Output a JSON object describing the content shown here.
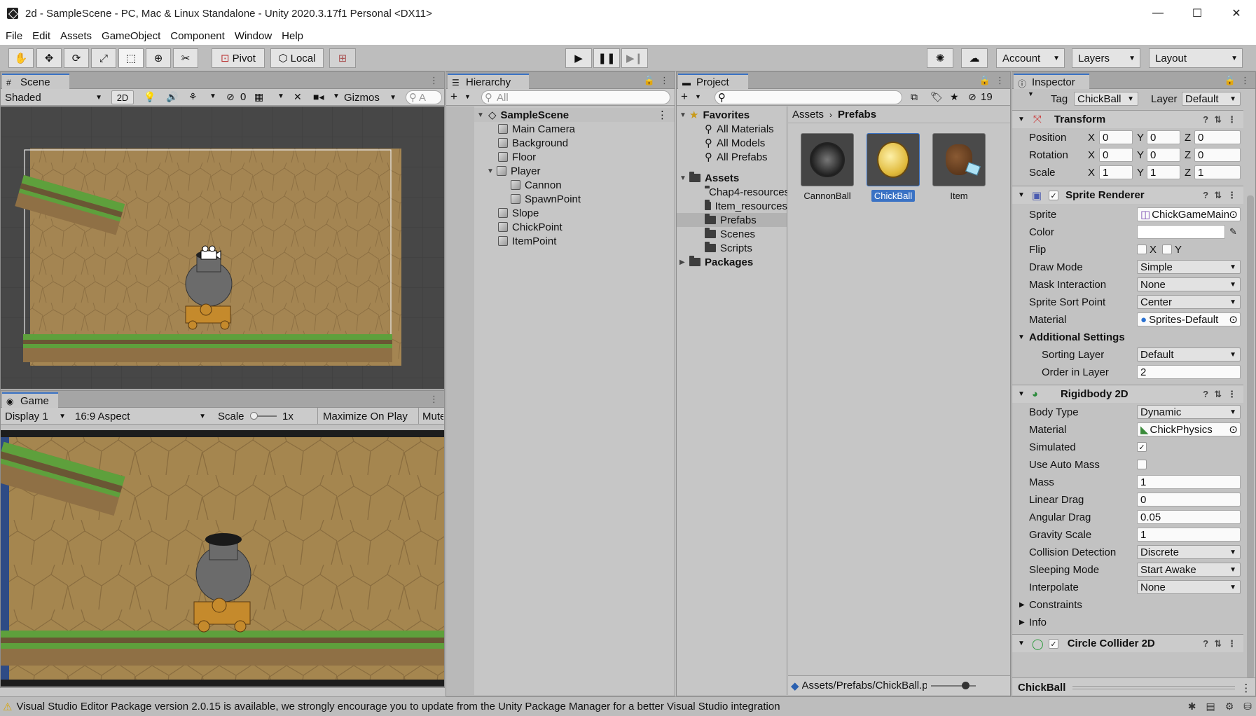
{
  "window": {
    "title": "2d - SampleScene - PC, Mac & Linux Standalone - Unity 2020.3.17f1 Personal <DX11>",
    "controls": [
      "—",
      "☐",
      "✕"
    ]
  },
  "menu": [
    "File",
    "Edit",
    "Assets",
    "GameObject",
    "Component",
    "Window",
    "Help"
  ],
  "toolbar": {
    "pivot": "Pivot",
    "local": "Local",
    "account": "Account",
    "layers": "Layers",
    "layout": "Layout"
  },
  "scene": {
    "tab": "Scene",
    "shading": "Shaded",
    "mode_2d": "2D",
    "hidden_count": "0",
    "gizmos": "Gizmos",
    "search_placeholder": "A"
  },
  "game": {
    "tab": "Game",
    "display": "Display 1",
    "aspect": "16:9 Aspect",
    "scale_label": "Scale",
    "scale_value": "1x",
    "maximize": "Maximize On Play",
    "mute": "Mute"
  },
  "hierarchy": {
    "tab": "Hierarchy",
    "search_placeholder": "All",
    "scene": "SampleScene",
    "items": [
      {
        "label": "Main Camera",
        "depth": 1
      },
      {
        "label": "Background",
        "depth": 1
      },
      {
        "label": "Floor",
        "depth": 1
      },
      {
        "label": "Player",
        "depth": 1,
        "expanded": true
      },
      {
        "label": "Cannon",
        "depth": 2
      },
      {
        "label": "SpawnPoint",
        "depth": 2
      },
      {
        "label": "Slope",
        "depth": 1
      },
      {
        "label": "ChickPoint",
        "depth": 1
      },
      {
        "label": "ItemPoint",
        "depth": 1
      }
    ]
  },
  "project": {
    "tab": "Project",
    "hidden_count": "19",
    "favorites": "Favorites",
    "favorite_items": [
      "All Materials",
      "All Models",
      "All Prefabs"
    ],
    "assets": "Assets",
    "asset_folders": [
      "Chap4-resources",
      "Item_resources",
      "Prefabs",
      "Scenes",
      "Scripts"
    ],
    "packages": "Packages",
    "breadcrumb": [
      "Assets",
      "Prefabs"
    ],
    "prefabs": [
      "CannonBall",
      "ChickBall",
      "Item"
    ],
    "selected_prefab": "ChickBall",
    "footer_path": "Assets/Prefabs/ChickBall.prefab"
  },
  "inspector": {
    "tab": "Inspector",
    "tag_label": "Tag",
    "tag_value": "ChickBall",
    "layer_label": "Layer",
    "layer_value": "Default",
    "transform": {
      "title": "Transform",
      "position_label": "Position",
      "rotation_label": "Rotation",
      "scale_label": "Scale",
      "position": [
        "0",
        "0",
        "0"
      ],
      "rotation": [
        "0",
        "0",
        "0"
      ],
      "scale": [
        "1",
        "1",
        "1"
      ]
    },
    "sprite_renderer": {
      "title": "Sprite Renderer",
      "sprite_label": "Sprite",
      "sprite": "ChickGameMain",
      "color_label": "Color",
      "flip_label": "Flip",
      "flip_x": "X",
      "flip_y": "Y",
      "draw_mode_label": "Draw Mode",
      "draw_mode": "Simple",
      "mask_label": "Mask Interaction",
      "mask": "None",
      "sort_point_label": "Sprite Sort Point",
      "sort_point": "Center",
      "material_label": "Material",
      "material": "Sprites-Default",
      "additional": "Additional Settings",
      "sorting_layer_label": "Sorting Layer",
      "sorting_layer": "Default",
      "order_label": "Order in Layer",
      "order": "2"
    },
    "rigidbody": {
      "title": "Rigidbody 2D",
      "body_type_label": "Body Type",
      "body_type": "Dynamic",
      "material_label": "Material",
      "material": "ChickPhysics",
      "simulated_label": "Simulated",
      "auto_mass_label": "Use Auto Mass",
      "mass_label": "Mass",
      "mass": "1",
      "linear_drag_label": "Linear Drag",
      "linear_drag": "0",
      "angular_drag_label": "Angular Drag",
      "angular_drag": "0.05",
      "gravity_label": "Gravity Scale",
      "gravity": "1",
      "collision_label": "Collision Detection",
      "collision": "Discrete",
      "sleeping_label": "Sleeping Mode",
      "sleeping": "Start Awake",
      "interpolate_label": "Interpolate",
      "interpolate": "None",
      "constraints": "Constraints",
      "info": "Info"
    },
    "circle_collider": {
      "title": "Circle Collider 2D"
    },
    "footer": "ChickBall"
  },
  "status": {
    "message": "Visual Studio Editor Package version 2.0.15 is available, we strongly encourage you to update from the Unity Package Manager for a better Visual Studio integration"
  }
}
